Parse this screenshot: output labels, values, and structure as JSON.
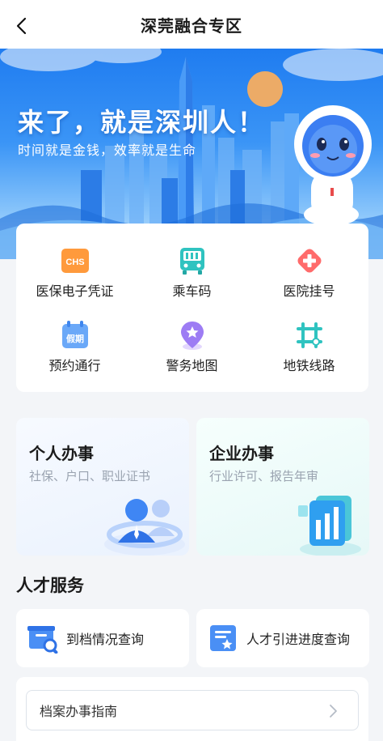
{
  "header": {
    "title": "深莞融合专区"
  },
  "banner": {
    "slogan": "来了，就是深圳人！",
    "subtitle": "时间就是金钱，效率就是生命"
  },
  "quick_services": [
    {
      "label": "医保电子凭证",
      "icon": "chs-icon"
    },
    {
      "label": "乘车码",
      "icon": "bus-icon"
    },
    {
      "label": "医院挂号",
      "icon": "hospital-icon"
    },
    {
      "label": "预约通行",
      "icon": "holiday-calendar-icon"
    },
    {
      "label": "警务地图",
      "icon": "police-map-pin-icon"
    },
    {
      "label": "地铁线路",
      "icon": "metro-line-icon"
    }
  ],
  "icon_texts": {
    "chs": "CHS",
    "holiday": "假期"
  },
  "services": {
    "personal": {
      "title": "个人办事",
      "desc": "社保、户口、职业证书"
    },
    "enterprise": {
      "title": "企业办事",
      "desc": "行业许可、报告年审"
    }
  },
  "talent": {
    "section_title": "人才服务",
    "items": [
      {
        "label": "到档情况查询",
        "icon": "archive-search-icon"
      },
      {
        "label": "人才引进进度查询",
        "icon": "certificate-icon"
      }
    ]
  },
  "guide": {
    "item_label": "档案办事指南"
  },
  "colors": {
    "primary_blue": "#2f86f4",
    "orange": "#ff9a3c",
    "teal": "#2fc3c0",
    "red": "#ff6b6b",
    "purple": "#9d7cf4"
  }
}
